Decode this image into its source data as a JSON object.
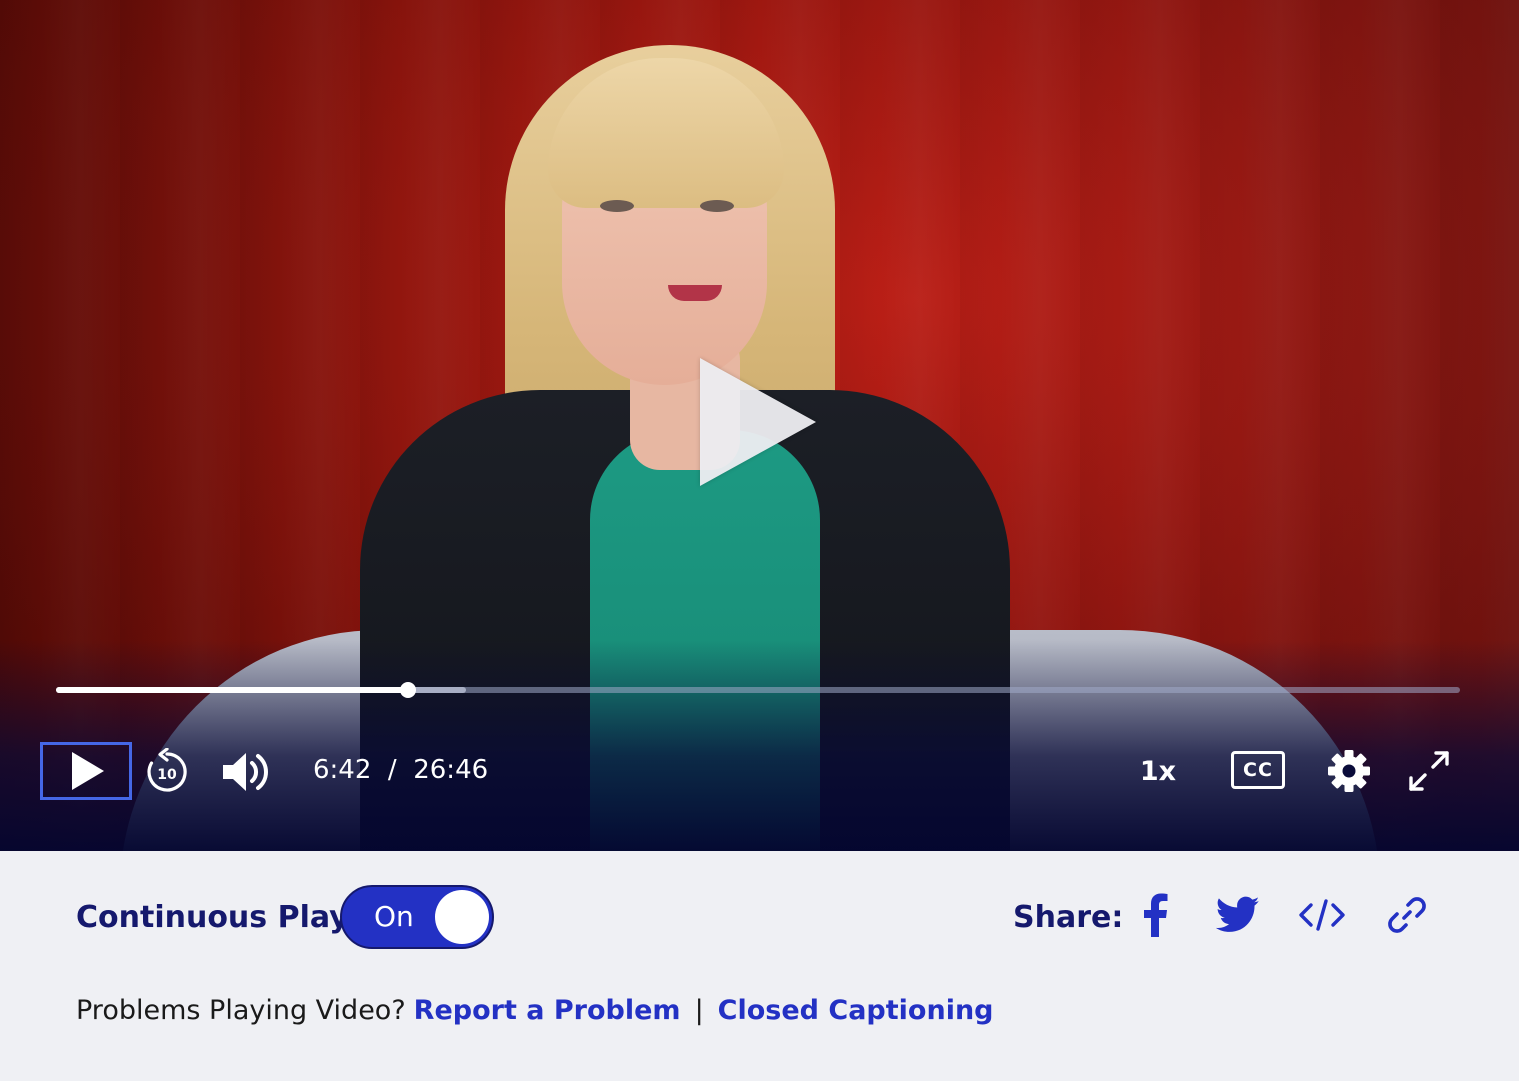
{
  "player": {
    "current_time": "6:42",
    "duration": "26:46",
    "time_separator": "/",
    "progress_fraction": 0.251,
    "buffered_fraction": 0.292,
    "speed_label": "1x",
    "cc_label": "CC",
    "rewind_seconds": "10",
    "icons": [
      "play-icon",
      "rewind-10-icon",
      "volume-icon",
      "cc-icon",
      "gear-icon",
      "fullscreen-icon",
      "big-play-icon"
    ]
  },
  "continuous_play": {
    "label": "Continuous Play:",
    "state_label": "On"
  },
  "share": {
    "label": "Share:",
    "icons": [
      "facebook-icon",
      "twitter-icon",
      "embed-code-icon",
      "link-icon"
    ]
  },
  "problems": {
    "prompt": "Problems Playing Video?",
    "report_link": "Report a Problem",
    "separator": "|",
    "captioning_link": "Closed Captioning"
  },
  "colors": {
    "accent": "#2331c4",
    "heading": "#15196d",
    "focus_ring": "#4567e6",
    "panel_bg": "#eff0f4"
  }
}
